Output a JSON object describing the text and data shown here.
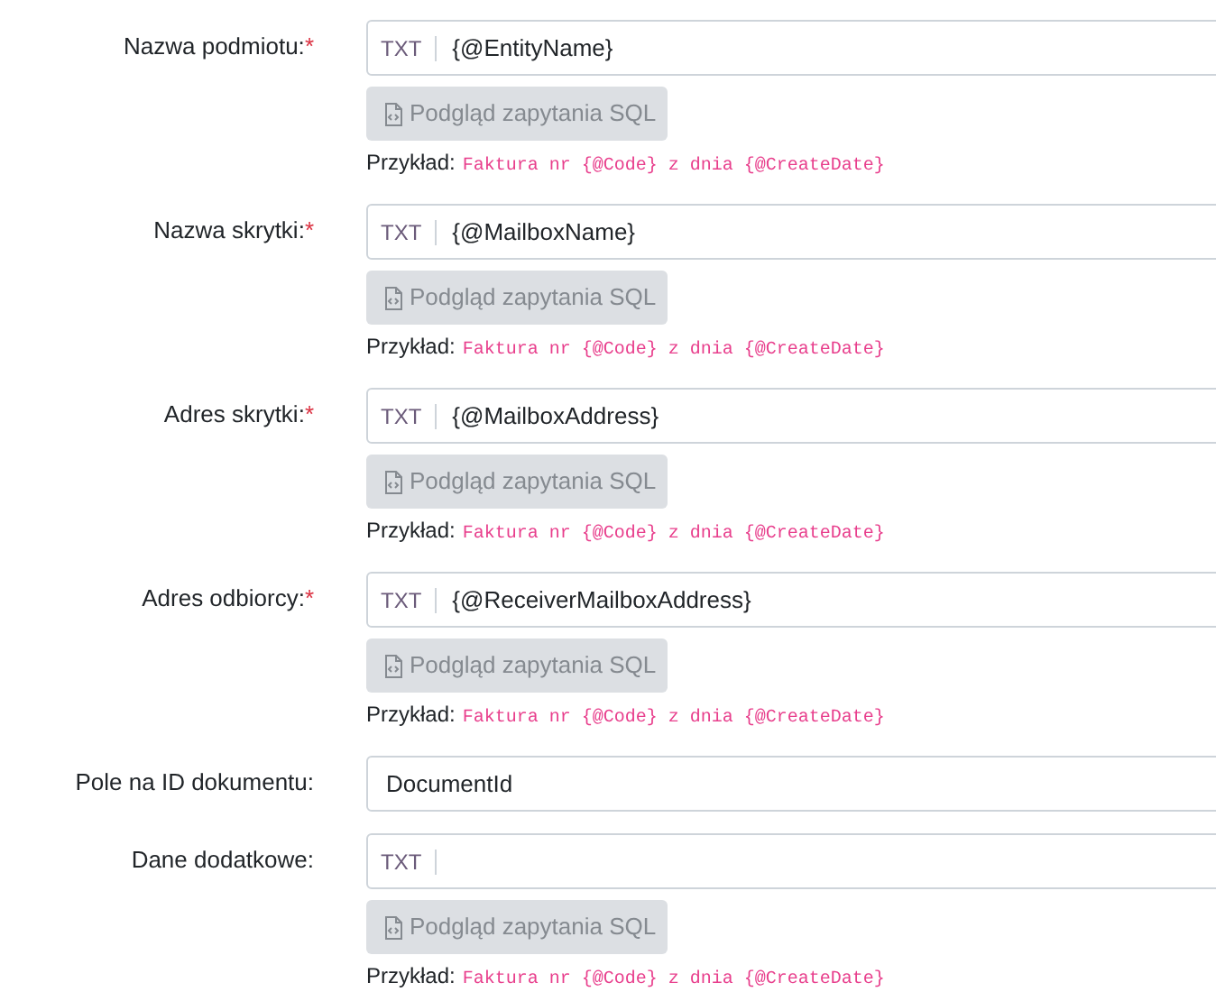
{
  "fields": [
    {
      "kind": "template",
      "label": "Nazwa podmiotu:",
      "required": "*",
      "prefix": "TXT",
      "value": "{@EntityName}",
      "button": {
        "label": "Podgląd zapytania SQL",
        "disabled": true
      },
      "example_label": "Przykład:",
      "example": "Faktura nr {@Code} z dnia {@CreateDate}"
    },
    {
      "kind": "template",
      "label": "Nazwa skrytki:",
      "required": "*",
      "prefix": "TXT",
      "value": "{@MailboxName}",
      "button": {
        "label": "Podgląd zapytania SQL",
        "disabled": true
      },
      "example_label": "Przykład:",
      "example": "Faktura nr {@Code} z dnia {@CreateDate}"
    },
    {
      "kind": "template",
      "label": "Adres skrytki:",
      "required": "*",
      "prefix": "TXT",
      "value": "{@MailboxAddress}",
      "button": {
        "label": "Podgląd zapytania SQL",
        "disabled": true
      },
      "example_label": "Przykład:",
      "example": "Faktura nr {@Code} z dnia {@CreateDate}"
    },
    {
      "kind": "template",
      "label": "Adres odbiorcy:",
      "required": "*",
      "prefix": "TXT",
      "value": "{@ReceiverMailboxAddress}",
      "button": {
        "label": "Podgląd zapytania SQL",
        "disabled": true
      },
      "example_label": "Przykład:",
      "example": "Faktura nr {@Code} z dnia {@CreateDate}"
    },
    {
      "kind": "plain",
      "label": "Pole na ID dokumentu:",
      "value": "DocumentId"
    },
    {
      "kind": "template",
      "label": "Dane dodatkowe:",
      "prefix": "TXT",
      "button": {
        "label": "Podgląd zapytania SQL",
        "disabled": true
      },
      "example_label": "Przykład:",
      "example": "Faktura nr {@Code} z dnia {@CreateDate}"
    }
  ]
}
